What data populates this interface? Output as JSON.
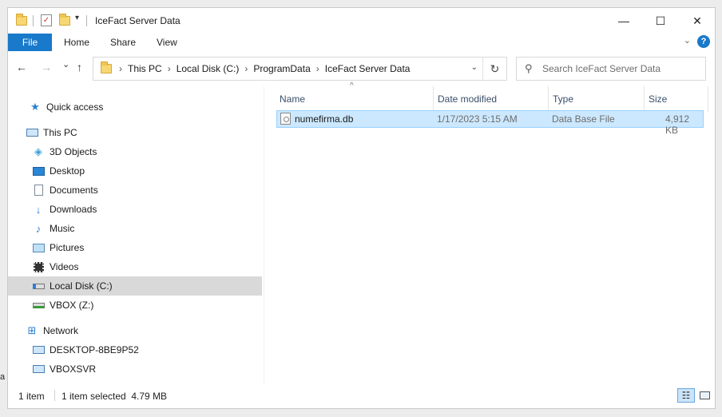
{
  "window": {
    "title": "IceFact Server Data",
    "controls": {
      "minimize": "—",
      "maximize": "☐",
      "close": "✕"
    }
  },
  "quick_access_toolbar": {
    "dropdown_glyph": "▾"
  },
  "ribbon": {
    "file_tab": "File",
    "tabs": [
      "Home",
      "Share",
      "View"
    ],
    "help": "?",
    "collapse_glyph": "⌄"
  },
  "navigation": {
    "back": "←",
    "forward": "→",
    "recent": "⌄",
    "up": "↑",
    "address": [
      "This PC",
      "Local Disk (C:)",
      "ProgramData",
      "IceFact Server Data"
    ],
    "crumb_separator": "›",
    "address_dropdown": "⌄",
    "refresh": "↻",
    "search_placeholder": "Search IceFact Server Data"
  },
  "nav_pane": {
    "quick_access": "Quick access",
    "this_pc": "This PC",
    "this_pc_items": [
      "3D Objects",
      "Desktop",
      "Documents",
      "Downloads",
      "Music",
      "Pictures",
      "Videos",
      "Local Disk (C:)",
      "VBOX (Z:)"
    ],
    "selected": "Local Disk (C:)",
    "network": "Network",
    "network_items": [
      "DESKTOP-8BE9P52",
      "VBOXSVR"
    ]
  },
  "file_list": {
    "columns": [
      "Name",
      "Date modified",
      "Type",
      "Size"
    ],
    "sort_glyph": "^",
    "rows": [
      {
        "name": "numefirma.db",
        "date_modified": "1/17/2023 5:15 AM",
        "type": "Data Base File",
        "size": "4,912 KB",
        "selected": true
      }
    ]
  },
  "status_bar": {
    "item_count": "1 item",
    "selection": "1 item selected  4.79 MB"
  },
  "colors": {
    "accent": "#1979ca",
    "selection_bg": "#cce8ff",
    "selection_border": "#99d1ff",
    "nav_selected_bg": "#d9d9d9"
  },
  "edge_char": "a"
}
